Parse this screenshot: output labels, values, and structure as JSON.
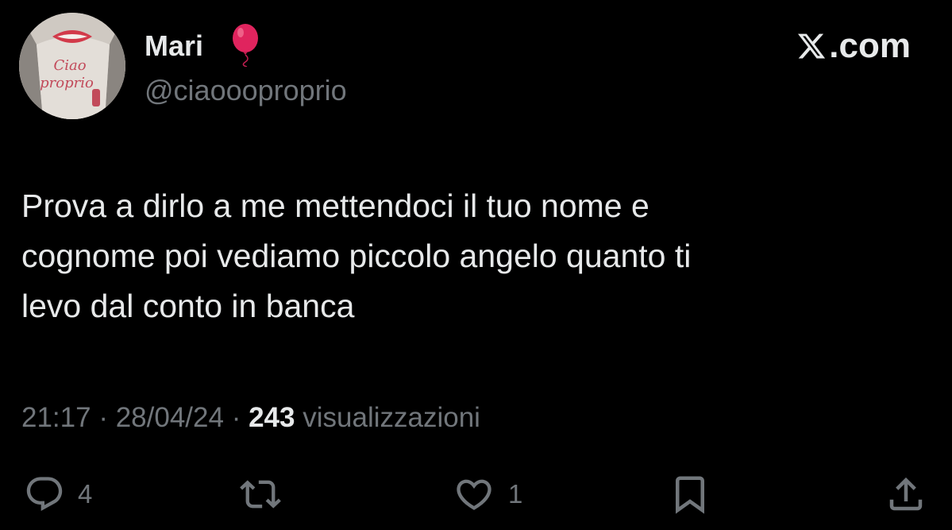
{
  "author": {
    "display_name": "Mari",
    "emoji_icon": "balloon-icon",
    "handle": "@ciaoooproprio",
    "avatar_text": "Ciao proprio"
  },
  "brand": {
    "logo_icon": "x-logo-icon",
    "text": ".com"
  },
  "tweet": {
    "text": "Prova a dirlo a me mettendoci il tuo nome e\ncognome poi vediamo piccolo angelo quanto ti\nlevo dal conto in banca",
    "time": "21:17",
    "date": "28/04/24",
    "separator": "·",
    "views_count": "243",
    "views_label": "visualizzazioni"
  },
  "actions": {
    "reply": {
      "icon": "reply-icon",
      "count": "4"
    },
    "retweet": {
      "icon": "retweet-icon",
      "count": ""
    },
    "like": {
      "icon": "heart-icon",
      "count": "1"
    },
    "bookmark": {
      "icon": "bookmark-icon"
    },
    "share": {
      "icon": "share-icon"
    }
  },
  "colors": {
    "background": "#000000",
    "primary_text": "#e7e9ea",
    "secondary_text": "#71767b",
    "balloon": "#e0245e"
  }
}
